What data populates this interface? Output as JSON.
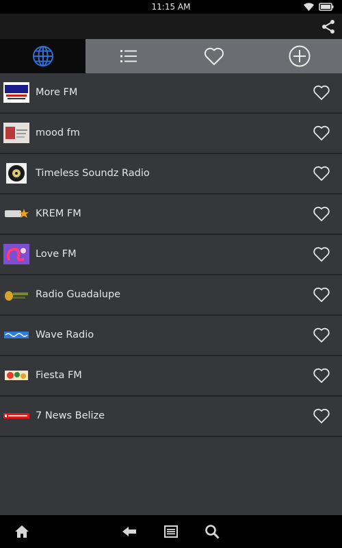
{
  "status_bar": {
    "time": "11:15 AM"
  },
  "tabs": [
    {
      "name": "tab-browse",
      "icon": "globe-icon",
      "active": true
    },
    {
      "name": "tab-list",
      "icon": "list-icon",
      "active": false
    },
    {
      "name": "tab-favorites",
      "icon": "heart-icon",
      "active": false
    },
    {
      "name": "tab-add",
      "icon": "plus-circle-icon",
      "active": false
    }
  ],
  "stations": [
    {
      "name": "More FM",
      "logo": "more-fm-logo"
    },
    {
      "name": "mood fm",
      "logo": "mood-fm-logo"
    },
    {
      "name": "Timeless Soundz Radio",
      "logo": "timeless-soundz-logo"
    },
    {
      "name": "KREM FM",
      "logo": "krem-fm-logo"
    },
    {
      "name": "Love FM",
      "logo": "love-fm-logo"
    },
    {
      "name": "Radio Guadalupe",
      "logo": "radio-guadalupe-logo"
    },
    {
      "name": "Wave Radio",
      "logo": "wave-radio-logo"
    },
    {
      "name": "Fiesta FM",
      "logo": "fiesta-fm-logo"
    },
    {
      "name": "7 News Belize",
      "logo": "7-news-belize-logo"
    }
  ],
  "colors": {
    "accent": "#2f6fd6",
    "list_background": "#35373b",
    "tab_bar": "#6a6d72",
    "active_tab": "#0b0b0c"
  },
  "bottom_nav": [
    "home-icon",
    "back-icon",
    "menu-icon",
    "search-icon"
  ]
}
